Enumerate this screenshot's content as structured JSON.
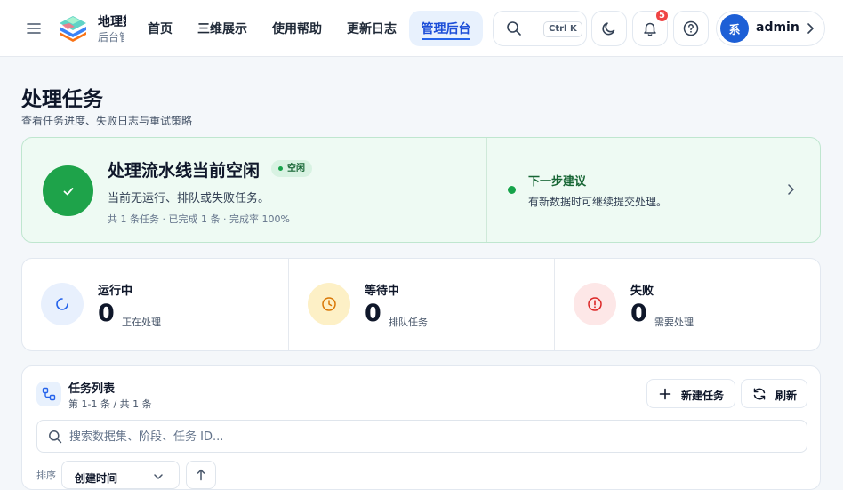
{
  "header": {
    "brand_title": "地理数据平台",
    "brand_subtitle": "后台管理",
    "nav": [
      {
        "label": "首页"
      },
      {
        "label": "三维展示"
      },
      {
        "label": "使用帮助"
      },
      {
        "label": "更新日志"
      },
      {
        "label": "管理后台",
        "active": true
      }
    ],
    "search_shortcut": "Ctrl K",
    "notification_count": "5",
    "user": {
      "avatar_text": "系",
      "name": "admin"
    }
  },
  "page": {
    "title": "处理任务",
    "subtitle": "查看任务进度、失败日志与重试策略"
  },
  "status": {
    "title": "处理流水线当前空闲",
    "badge": "空闲",
    "description": "当前无运行、排队或失败任务。",
    "meta": "共 1 条任务 · 已完成 1 条 · 完成率 100%",
    "next_title": "下一步建议",
    "next_description": "有新数据时可继续提交处理。"
  },
  "stats": [
    {
      "label": "运行中",
      "value": "0",
      "note": "正在处理",
      "icon": "spinner-icon",
      "color": "#2563eb"
    },
    {
      "label": "等待中",
      "value": "0",
      "note": "排队任务",
      "icon": "clock-icon",
      "color": "#d97706"
    },
    {
      "label": "失败",
      "value": "0",
      "note": "需要处理",
      "icon": "alert-circle-icon",
      "color": "#dc2626"
    }
  ],
  "task_list": {
    "title": "任务列表",
    "count": "第 1-1 条 / 共 1 条",
    "new_task_label": "新建任务",
    "refresh_label": "刷新",
    "search_placeholder": "搜索数据集、阶段、任务 ID...",
    "sort_label": "排序",
    "sort_value": "创建时间"
  },
  "colors": {
    "accent": "#2563eb",
    "success": "#16a34a",
    "warning": "#d97706",
    "danger": "#dc2626"
  }
}
